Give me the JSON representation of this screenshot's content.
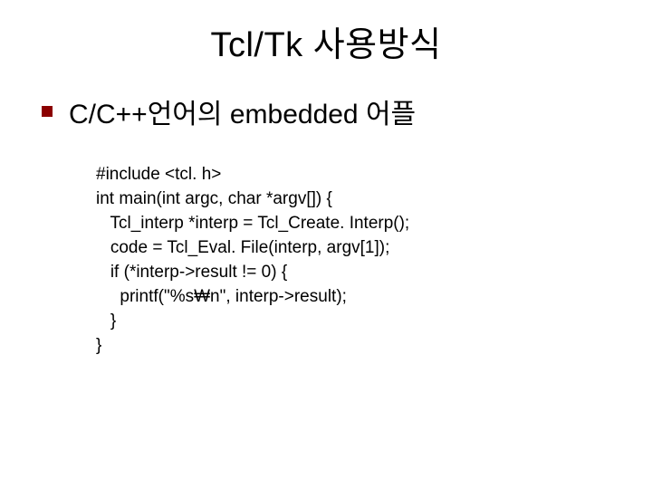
{
  "title": "Tcl/Tk 사용방식",
  "bullet": "C/C++언어의 embedded 어플",
  "code": {
    "l1": "#include <tcl. h>",
    "l2": "int main(int argc, char *argv[]) {",
    "l3": "   Tcl_interp *interp = Tcl_Create. Interp();",
    "l4": "   code = Tcl_Eval. File(interp, argv[1]);",
    "l5": "   if (*interp->result != 0) {",
    "l6": "     printf(\"%s₩n\", interp->result);",
    "l7": "   }",
    "l8": "}"
  }
}
